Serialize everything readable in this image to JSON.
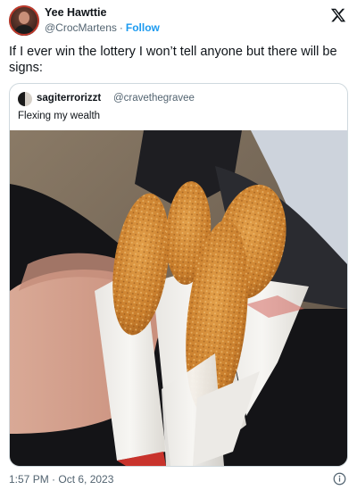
{
  "author": {
    "name": "Yee Hawttie",
    "handle": "@CrocMartens",
    "separator": "·",
    "follow_label": "Follow"
  },
  "icons": {
    "platform_logo": "x-logo-icon",
    "info": "info-icon"
  },
  "tweet": {
    "text": "If I ever win the lottery I won’t tell anyone but there will be signs:"
  },
  "quoted_tweet": {
    "name": "sagiterrorizzt",
    "handle": "@cravethegravee",
    "text": "Flexing my wealth"
  },
  "footer": {
    "timestamp": "1:57 PM · Oct 6, 2023"
  },
  "colors": {
    "accent": "#1d9bf0",
    "text": "#0f1419",
    "secondary": "#536471",
    "border": "#cfd9de"
  }
}
